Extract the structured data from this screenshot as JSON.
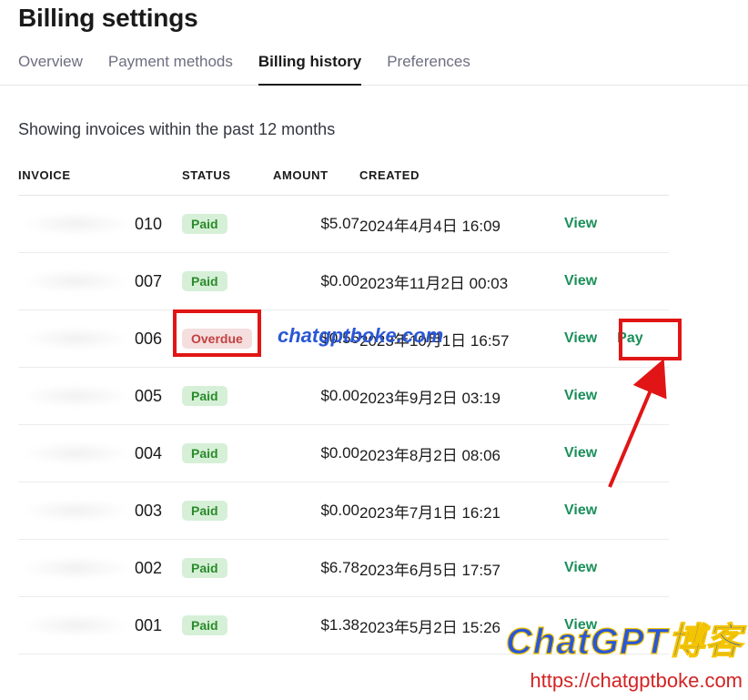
{
  "page_title": "Billing settings",
  "tabs": {
    "overview": "Overview",
    "payment_methods": "Payment methods",
    "billing_history": "Billing history",
    "preferences": "Preferences",
    "active": "billing_history"
  },
  "caption": "Showing invoices within the past 12 months",
  "columns": {
    "invoice": "INVOICE",
    "status": "STATUS",
    "amount": "AMOUNT",
    "created": "CREATED"
  },
  "status_labels": {
    "paid": "Paid",
    "overdue": "Overdue"
  },
  "action_labels": {
    "view": "View",
    "pay": "Pay"
  },
  "invoices": [
    {
      "suffix": "010",
      "status": "paid",
      "amount": "$5.07",
      "created": "2024年4月4日 16:09",
      "actions": [
        "view"
      ]
    },
    {
      "suffix": "007",
      "status": "paid",
      "amount": "$0.00",
      "created": "2023年11月2日 00:03",
      "actions": [
        "view"
      ]
    },
    {
      "suffix": "006",
      "status": "overdue",
      "amount": "$0.55",
      "created": "2023年10月1日 16:57",
      "actions": [
        "view",
        "pay"
      ]
    },
    {
      "suffix": "005",
      "status": "paid",
      "amount": "$0.00",
      "created": "2023年9月2日 03:19",
      "actions": [
        "view"
      ]
    },
    {
      "suffix": "004",
      "status": "paid",
      "amount": "$0.00",
      "created": "2023年8月2日 08:06",
      "actions": [
        "view"
      ]
    },
    {
      "suffix": "003",
      "status": "paid",
      "amount": "$0.00",
      "created": "2023年7月1日 16:21",
      "actions": [
        "view"
      ]
    },
    {
      "suffix": "002",
      "status": "paid",
      "amount": "$6.78",
      "created": "2023年6月5日 17:57",
      "actions": [
        "view"
      ]
    },
    {
      "suffix": "001",
      "status": "paid",
      "amount": "$1.38",
      "created": "2023年5月2日 15:26",
      "actions": [
        "view"
      ]
    }
  ],
  "watermark": {
    "center": "chatgptboke.com",
    "brand": "ChatGPT博客",
    "url": "https://chatgptboke.com"
  },
  "annotations": {
    "highlight_status_row_index": 2,
    "highlight_pay_button_row_index": 2,
    "arrow_points_to": "pay-button"
  }
}
